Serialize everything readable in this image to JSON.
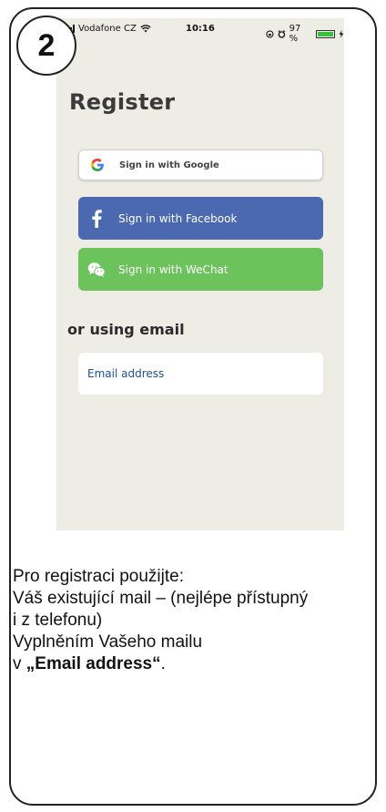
{
  "step": {
    "number": "2"
  },
  "status_bar": {
    "carrier": "Vodafone CZ",
    "time": "10:16",
    "battery": "97 %",
    "battery_level": 0.97
  },
  "screen": {
    "title": "Register",
    "buttons": {
      "google": "Sign in with Google",
      "facebook": "Sign in with Facebook",
      "wechat": "Sign in with WeChat"
    },
    "email_section_title": "or using email",
    "email_field": {
      "placeholder": "Email address",
      "value": ""
    }
  },
  "instructions": {
    "line1": "Pro registraci použijte:",
    "line2": "Váš existující mail – (nejlépe přístupný",
    "line3": "i z telefonu)",
    "line4": "Vyplněním Vašeho mailu",
    "line5_prefix": "v ",
    "line5_bold": "„Email address“",
    "line5_suffix": "."
  },
  "colors": {
    "screen_bg": "#edede6",
    "facebook": "#4a69b0",
    "wechat": "#6cc35c",
    "link_blue": "#1b4f9c"
  },
  "icons": [
    "signal-icon",
    "wifi-icon",
    "rotation-lock-icon",
    "alarm-icon",
    "battery-icon",
    "charging-icon",
    "google-icon",
    "facebook-icon",
    "wechat-icon"
  ]
}
